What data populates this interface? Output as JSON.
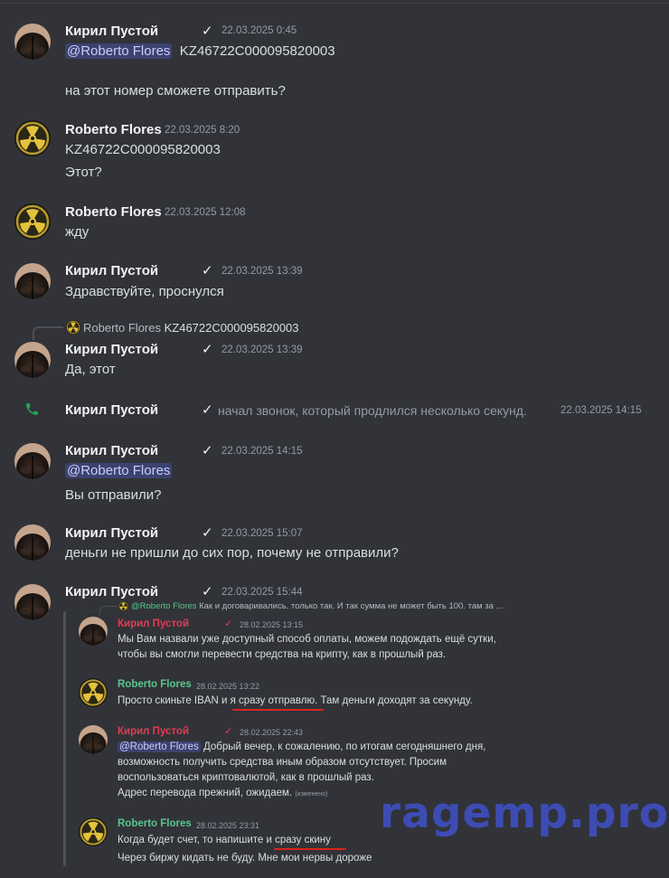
{
  "users": {
    "kiril": "Кирил Пустой",
    "roberto": "Roberto Flores"
  },
  "mention": "@Roberto Flores",
  "check": "✓",
  "messages": [
    {
      "ts": "22.03.2025 0:45",
      "line1": "KZ46722C000095820003",
      "line2": "на этот номер сможете отправить?"
    },
    {
      "ts": "22.03.2025 8:20",
      "line1": "KZ46722C000095820003",
      "line2": "Этот?"
    },
    {
      "ts": "22.03.2025 12:08",
      "line1": "жду"
    },
    {
      "ts": "22.03.2025 13:39",
      "line1": "Здравствуйте, проснулся"
    },
    {
      "reply": "KZ46722C000095820003",
      "ts": "22.03.2025 13:39",
      "line1": "Да, этот"
    },
    {
      "call_text": "начал звонок, который продлился несколько секунд.",
      "ts": "22.03.2025 14:15"
    },
    {
      "ts": "22.03.2025 14:15",
      "line2": "Вы отправили?"
    },
    {
      "ts": "22.03.2025 15:07",
      "line1": "деньги не пришли до сих пор, почему не отправили?"
    },
    {
      "ts": "22.03.2025 15:44"
    }
  ],
  "screenshot": {
    "reply_text": "Как и договаривались. только так. И так сумма не может быть 100. там за ...",
    "items": [
      {
        "ts": "28.02.2025 13:15",
        "lines": [
          "Мы Вам назвали уже доступный способ оплаты, можем подождать ещё сутки,",
          "чтобы вы смогли перевести средства на крипту, как в прошлый раз."
        ]
      },
      {
        "ts": "28.02.2025 13:22",
        "lines": [
          "Просто скиньте IBAN и я сразу отправлю. Там деньги доходят за секунду."
        ]
      },
      {
        "ts": "28.02.2025 22:43",
        "lines": [
          "Добрый вечер, к сожалению, по итогам сегодняшнего дня,",
          "возможность получить средства иным образом отсутствует. Просим",
          "воспользоваться криптовалютой, как в прошлый раз.",
          "Адрес перевода прежний, ожидаем."
        ],
        "edited": "(изменено)"
      },
      {
        "ts": "28.02.2025 23:31",
        "lines": [
          "Когда будет счет, то напишите и сразу скину",
          "Через биржу кидать не буду. Мне мои нервы дороже"
        ]
      }
    ]
  },
  "watermark": "ragemp.pro",
  "colors": {
    "background": "#313338",
    "mention_bg": "#3c4270",
    "red_name": "#e23c55",
    "green_name": "#58c78d",
    "underline": "#d9251e",
    "call_icon": "#23a55a",
    "watermark": "#3d4cb4"
  }
}
